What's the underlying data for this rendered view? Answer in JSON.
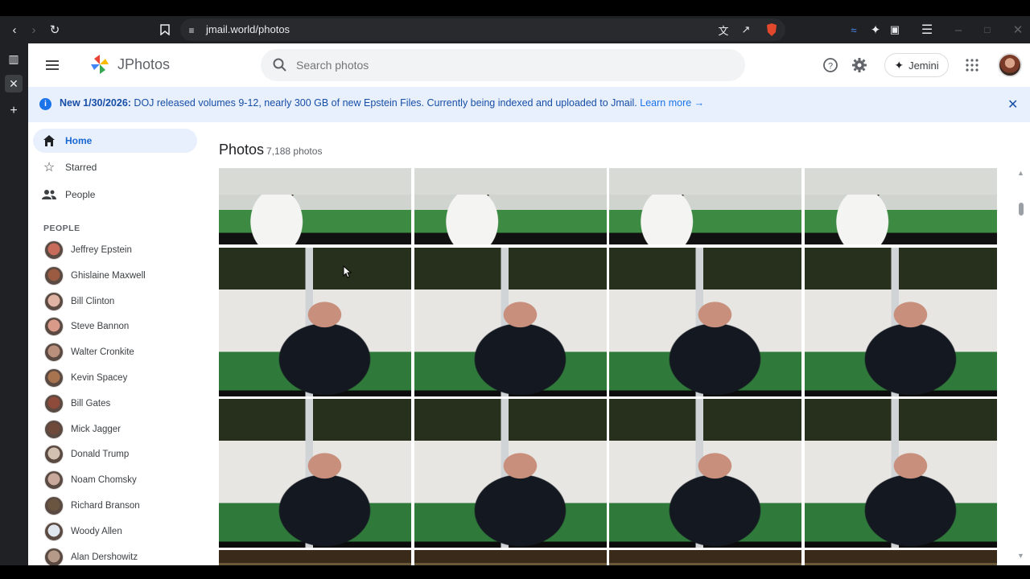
{
  "browser": {
    "url": "jmail.world/photos"
  },
  "app": {
    "brand": "JPhotos",
    "search_placeholder": "Search photos",
    "jemini_label": "Jemini"
  },
  "banner": {
    "bold": "New 1/30/2026:",
    "text": " DOJ released volumes 9-12, nearly 300 GB of new Epstein Files. Currently being indexed and uploaded to Jmail.",
    "link": "Learn more →"
  },
  "sidebar": {
    "nav": [
      {
        "label": "Home",
        "icon": "home-icon"
      },
      {
        "label": "Starred",
        "icon": "star-icon"
      },
      {
        "label": "People",
        "icon": "people-icon"
      }
    ],
    "people_header": "PEOPLE",
    "people": [
      "Jeffrey Epstein",
      "Ghislaine Maxwell",
      "Bill Clinton",
      "Steve Bannon",
      "Walter Cronkite",
      "Kevin Spacey",
      "Bill Gates",
      "Mick Jagger",
      "Donald Trump",
      "Noam Chomsky",
      "Richard Branson",
      "Woody Allen",
      "Alan Dershowitz"
    ]
  },
  "main": {
    "title": "Photos",
    "count": "7,188 photos"
  },
  "colors": {
    "accent": "#1a73e8",
    "banner_bg": "#e8f0fe",
    "nav_active_bg": "#e8f0fe"
  }
}
